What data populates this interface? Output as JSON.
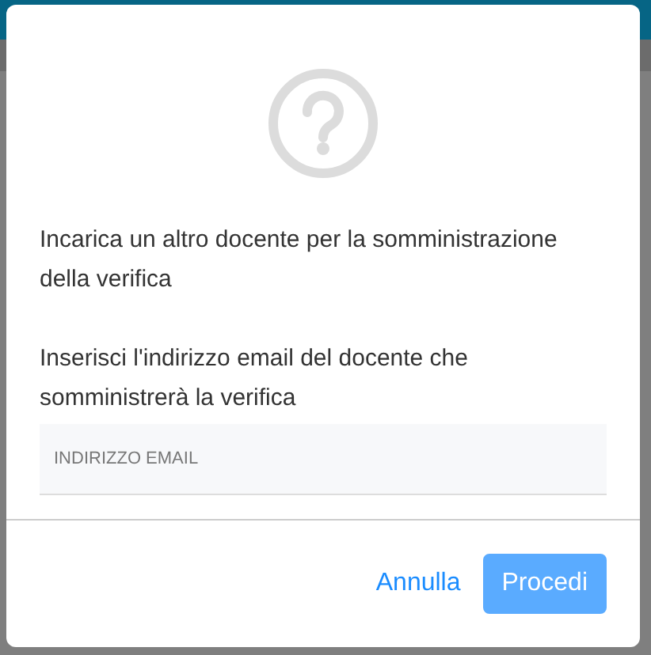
{
  "dialog": {
    "message": "Incarica un altro docente per la somministrazione della verifica",
    "prompt": "Inserisci l'indirizzo email del docente che somministrerà la verifica",
    "email_field": {
      "placeholder": "INDIRIZZO EMAIL"
    },
    "buttons": [
      {
        "label": "Annulla",
        "kind": "link",
        "disabled": false
      },
      {
        "label": "Procedi",
        "kind": "primary",
        "disabled": true
      }
    ]
  }
}
